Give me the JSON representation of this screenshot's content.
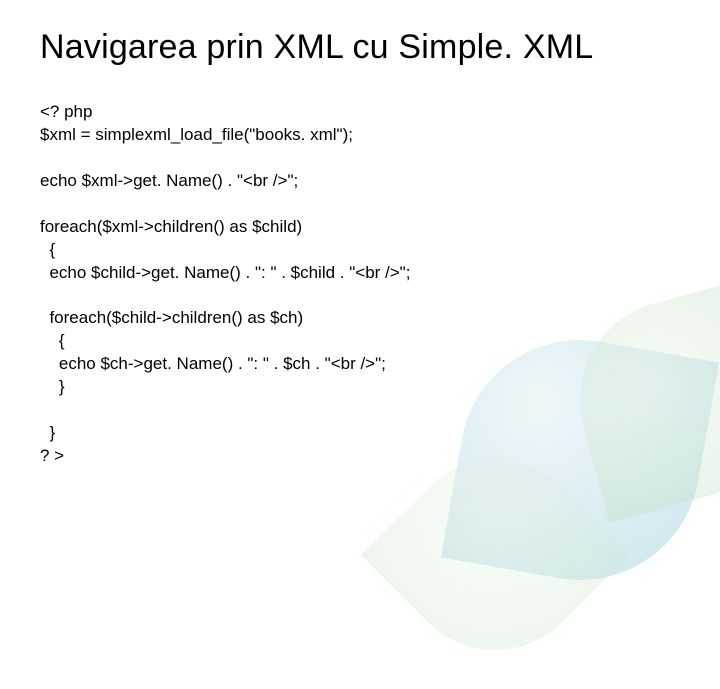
{
  "slide": {
    "title": "Navigarea prin XML cu Simple. XML",
    "code": {
      "l01": "<? php",
      "l02": "$xml = simplexml_load_file(\"books. xml\");",
      "l03": "",
      "l04": "echo $xml->get. Name() . \"<br />\";",
      "l05": "",
      "l06": "foreach($xml->children() as $child)",
      "l07": "  {",
      "l08": "  echo $child->get. Name() . \": \" . $child . \"<br />\";",
      "l09": "",
      "l10": "  foreach($child->children() as $ch)",
      "l11": "    {",
      "l12": "    echo $ch->get. Name() . \": \" . $ch . \"<br />\";",
      "l13": "    }",
      "l14": "",
      "l15": "  }",
      "l16": "? >"
    }
  }
}
